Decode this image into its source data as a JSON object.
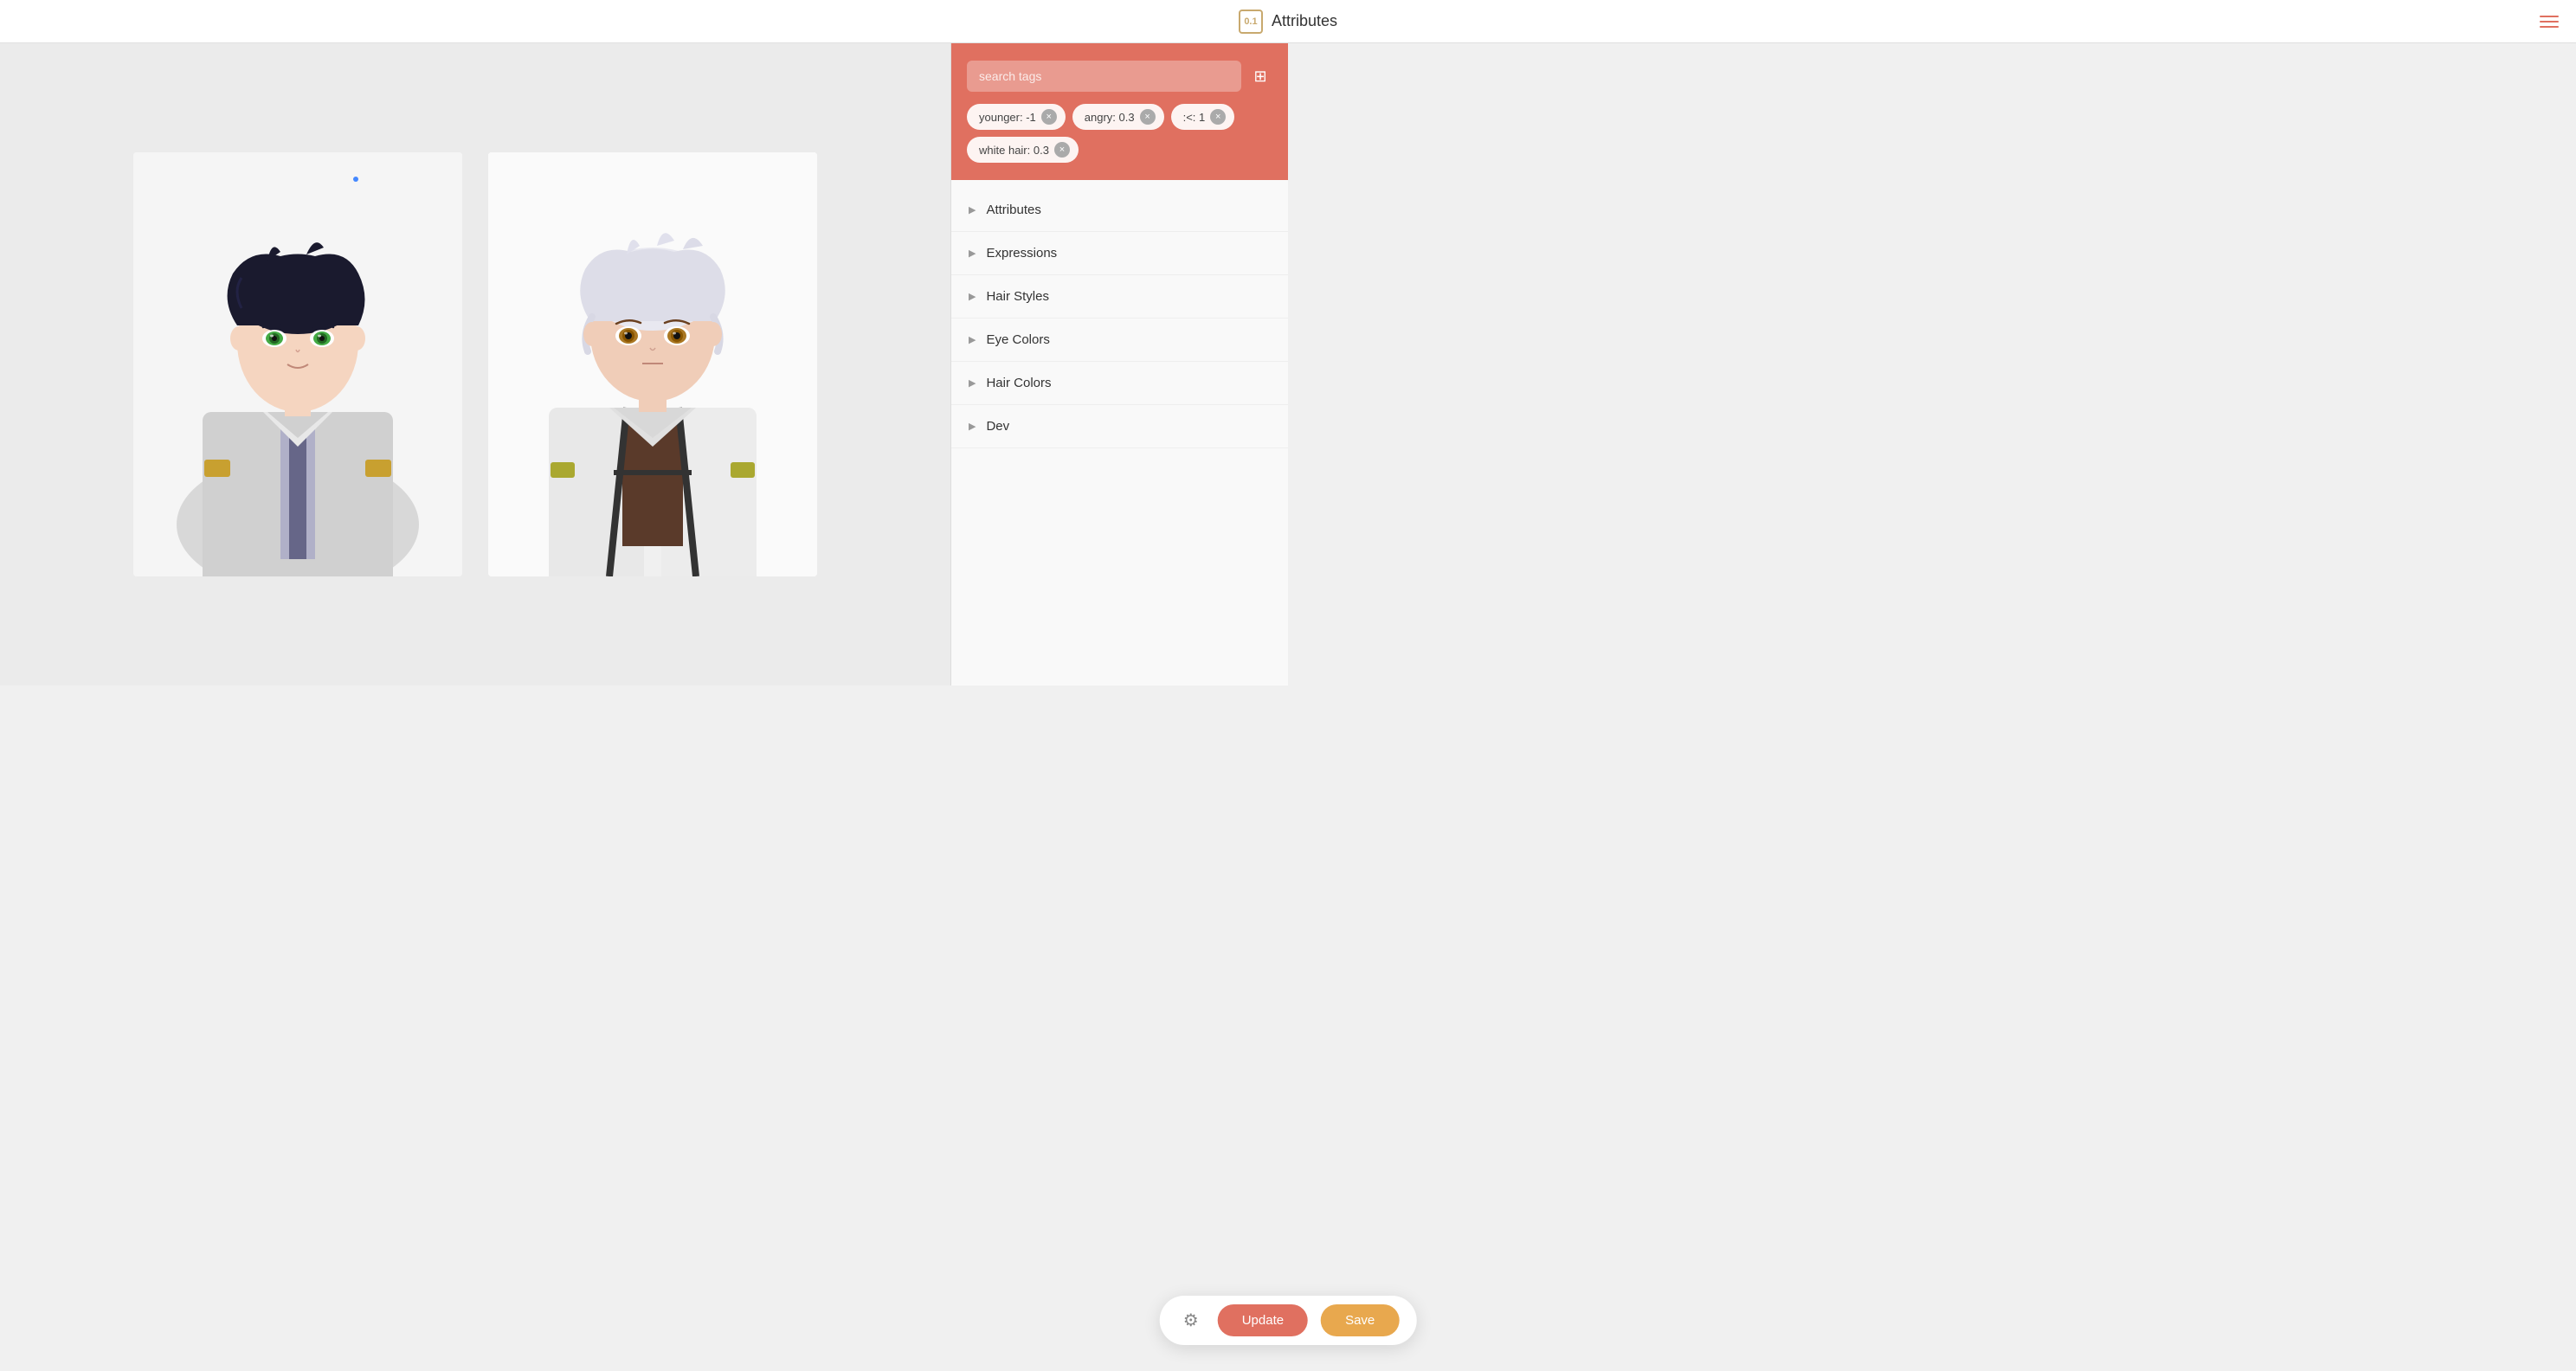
{
  "header": {
    "logo_text": "0.1",
    "title": "Attributes",
    "menu_label": "menu"
  },
  "search": {
    "placeholder": "search tags",
    "add_tooltip": "add tag"
  },
  "tags": [
    {
      "id": "t1",
      "label": "younger: -1"
    },
    {
      "id": "t2",
      "label": "angry: 0.3"
    },
    {
      "id": "t3",
      "label": ":<: 1"
    },
    {
      "id": "t4",
      "label": "white hair: 0.3"
    }
  ],
  "categories": [
    {
      "id": "c1",
      "label": "Attributes"
    },
    {
      "id": "c2",
      "label": "Expressions"
    },
    {
      "id": "c3",
      "label": "Hair Styles"
    },
    {
      "id": "c4",
      "label": "Eye Colors"
    },
    {
      "id": "c5",
      "label": "Hair Colors"
    },
    {
      "id": "c6",
      "label": "Dev"
    }
  ],
  "toolbar": {
    "update_label": "Update",
    "save_label": "Save",
    "gear_icon": "⚙"
  },
  "images": [
    {
      "id": "img1",
      "alt": "Dark-haired anime character"
    },
    {
      "id": "img2",
      "alt": "White-haired anime character"
    }
  ]
}
